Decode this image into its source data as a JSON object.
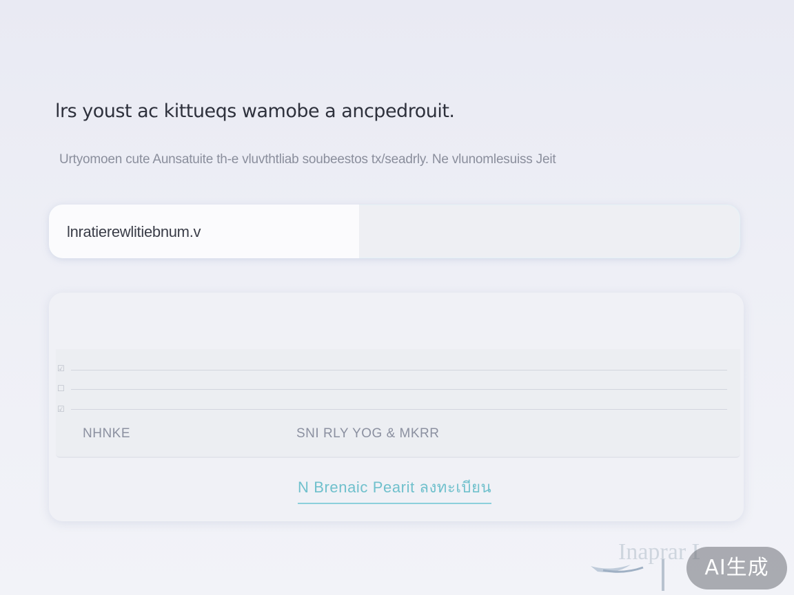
{
  "header": {
    "title": "lrs youst ac kittueqs wamobe a ancpedrouit.",
    "subtitle": "Urtyomoen cute Aunsatuite th-e vluvthtliab soubeestos tx/seadrly. Ne vlunomlesuiss Jeit"
  },
  "input": {
    "value": "lnratierewlitiebnum.v"
  },
  "card": {
    "columns": [
      "NHNKE",
      "SNI RLY YOG & MKRR"
    ],
    "link_label": "N Brenaic Pearit ลงทะเบียน"
  },
  "watermark": {
    "logo_text": "Inaprar Lrlacir",
    "badge_label": "AI生成"
  },
  "colors": {
    "accent": "#6fc0cc",
    "title": "#2e313c",
    "muted": "#8a8e9c",
    "background": "#eceef5"
  }
}
